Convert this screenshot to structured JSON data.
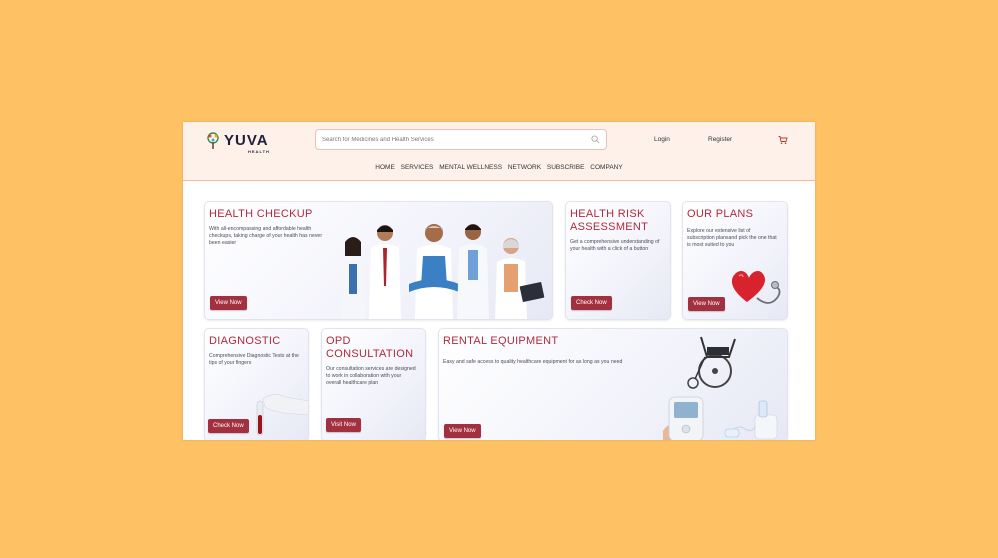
{
  "brand": {
    "name": "YUVA",
    "tagline": "HEALTH"
  },
  "search": {
    "placeholder": "Search for Medicines and Health Services"
  },
  "header": {
    "login": "Login",
    "register": "Register"
  },
  "nav": [
    "HOME",
    "SERVICES",
    "MENTAL WELLNESS",
    "NETWORK",
    "SUBSCRIBE",
    "COMPANY"
  ],
  "cards": {
    "health_checkup": {
      "title": "HEALTH CHECKUP",
      "desc": "With all-encompassing and affordable health checkups, taking charge of your health has never been easier",
      "button": "View Now"
    },
    "health_risk": {
      "title": "HEALTH RISK ASSESSMENT",
      "desc": "Get a comprehensive understanding of your health with a click of a button",
      "button": "Check Now"
    },
    "our_plans": {
      "title": "OUR PLANS",
      "desc": "Explore our extensive list of subscription plansand pick the one that is most suited to you",
      "button": "View Now"
    },
    "diagnostic": {
      "title": "DIAGNOSTIC",
      "desc": "Comprehensive Diagnostic Tests at the tips of your fingers",
      "button": "Check Now"
    },
    "opd": {
      "title": "OPD CONSULTATION",
      "desc": "Our consultation services are designed to work in collaboration with your overall healthcare plan",
      "button": "Visit Now"
    },
    "rental": {
      "title": "RENTAL EQUIPMENT",
      "desc": "Easy and safe access to quality healthcare equipment for as long as you need",
      "button": "View Now"
    }
  },
  "colors": {
    "background": "#fec163",
    "accent": "#a3303f",
    "title": "#b02a3c",
    "header_bg": "#fdf1ea"
  },
  "icons": [
    "search-icon",
    "cart-icon",
    "tree-logo-icon"
  ]
}
